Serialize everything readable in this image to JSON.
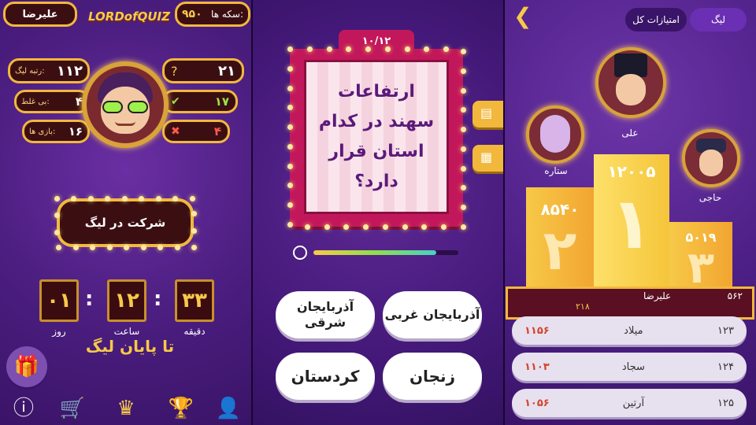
{
  "left": {
    "username": "علیرضا",
    "logo": "LORDofQUIZ",
    "coins_label": "سکه ها:",
    "coins_value": "۹۵۰",
    "league_rank_label": "رتبه لیگ:",
    "league_rank_value": "۱۱۲",
    "wrong_label": "بی غلط:",
    "wrong_value": "۴",
    "games_label": "بازی ها:",
    "games_value": "۱۶",
    "question_value": "۲۱",
    "correct_value": "۱۷",
    "incorrect_value": "۴",
    "join_league": "شرکت در لیگ",
    "timer": {
      "days": "۰۱",
      "hours": "۱۲",
      "minutes": "۳۳",
      "days_label": "روز",
      "hours_label": "ساعت",
      "minutes_label": "دقیقه",
      "ends_label": "تا پایان لیگ"
    },
    "nav": [
      "info-icon",
      "cart-icon",
      "podium-icon",
      "trophy-icon",
      "profile-icon"
    ]
  },
  "middle": {
    "progress": "۱۰/۱۲",
    "question": "ارتفاعات سهند در کدام استان قرار دارد؟",
    "timer_fraction": 0.85,
    "answers": [
      "آذربایجان غربی",
      "آذربایجان شرقی",
      "زنجان",
      "کردستان"
    ]
  },
  "right": {
    "tab_league": "لیگ",
    "tab_total": "امتیازات کل",
    "first": {
      "name": "علی",
      "score": "۱۲۰۰۵",
      "rank": "۱"
    },
    "second": {
      "name": "ستاره",
      "score": "۸۵۴۰",
      "rank": "۲"
    },
    "third": {
      "name": "حاجی",
      "score": "۵۰۱۹",
      "rank": "۳"
    },
    "me": {
      "rank": "۵۶۲",
      "name": "علیرضا",
      "score": "۲۱۸"
    },
    "rows": [
      {
        "rank": "۱۲۳",
        "name": "میلاد",
        "score": "۱۱۵۶"
      },
      {
        "rank": "۱۲۴",
        "name": "سجاد",
        "score": "۱۱۰۳"
      },
      {
        "rank": "۱۲۵",
        "name": "آرتین",
        "score": "۱۰۵۶"
      }
    ]
  }
}
